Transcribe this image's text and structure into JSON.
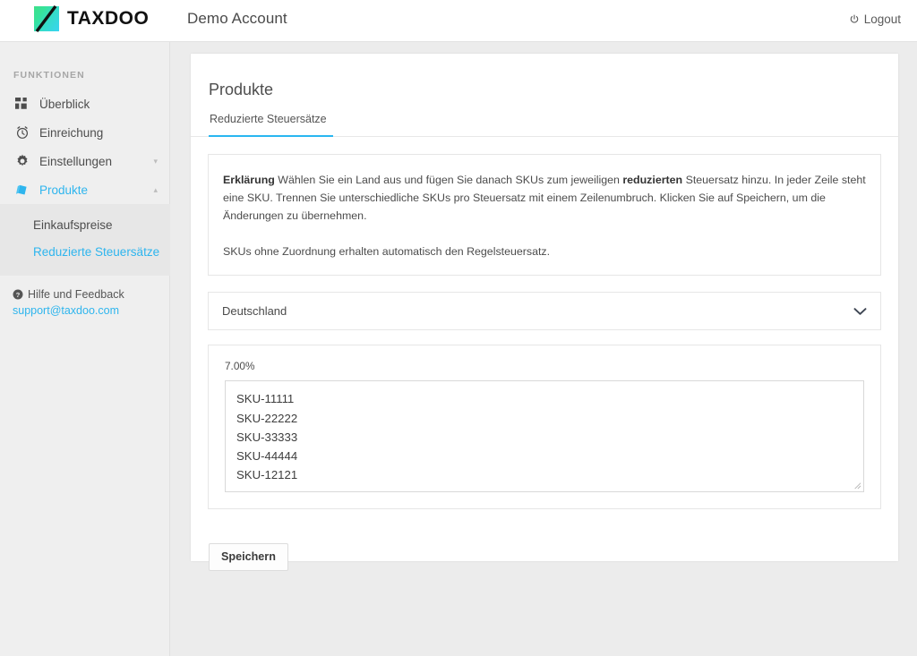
{
  "colors": {
    "accent": "#2eb5ee",
    "tab_underline": "#29b6f0",
    "sidebar_bg": "#efefef",
    "submenu_bg": "#e7e7e7",
    "page_bg": "#ececec",
    "card_bg": "#ffffff",
    "logo_gradient_from": "#3ee08a",
    "logo_gradient_to": "#38d4f2"
  },
  "topbar": {
    "logo_icon": "taxdoo-logo-icon",
    "logo_text": "TAXDOO",
    "account_name": "Demo Account",
    "logout_icon": "power-icon",
    "logout_label": "Logout"
  },
  "sidebar": {
    "section_label": "FUNKTIONEN",
    "items": [
      {
        "label": "Überblick",
        "icon": "grid-dashboard-icon",
        "active": false,
        "caret": ""
      },
      {
        "label": "Einreichung",
        "icon": "alarm-clock-icon",
        "active": false,
        "caret": ""
      },
      {
        "label": "Einstellungen",
        "icon": "gear-icon",
        "active": false,
        "caret": "▾"
      },
      {
        "label": "Produkte",
        "icon": "box-cube-icon",
        "active": true,
        "caret": "▴"
      }
    ],
    "submenu": [
      {
        "label": "Einkaufspreise",
        "active": false
      },
      {
        "label": "Reduzierte Steuersätze",
        "active": true
      }
    ],
    "help": {
      "icon": "question-circle-icon",
      "label": "Hilfe und Feedback",
      "email": "support@taxdoo.com"
    }
  },
  "main": {
    "page_title": "Produkte",
    "tabs": [
      {
        "label": "Reduzierte Steuersätze",
        "active": true
      }
    ],
    "explanation": {
      "lead": "Erklärung",
      "text_part1": " Wählen Sie ein Land aus und fügen Sie danach SKUs zum jeweiligen ",
      "bold_word": "reduzierten",
      "text_part2": " Steuersatz hinzu. In jeder Zeile steht eine SKU. Trennen Sie unterschiedliche SKUs pro Steuersatz mit einem Zeilenumbruch. Klicken Sie auf Speichern, um die Änderungen zu übernehmen.",
      "second_paragraph": "SKUs ohne Zuordnung erhalten automatisch den Regelsteuersatz."
    },
    "country_select": {
      "selected": "Deutschland",
      "chevron_icon": "chevron-down-icon"
    },
    "rate_section": {
      "rate_label": "7.00%",
      "skus_value": "SKU-11111\nSKU-22222\nSKU-33333\nSKU-44444\nSKU-12121",
      "skus_placeholder": "",
      "resize_handle_icon": "resize-grip-icon"
    },
    "save_label": "Speichern"
  }
}
